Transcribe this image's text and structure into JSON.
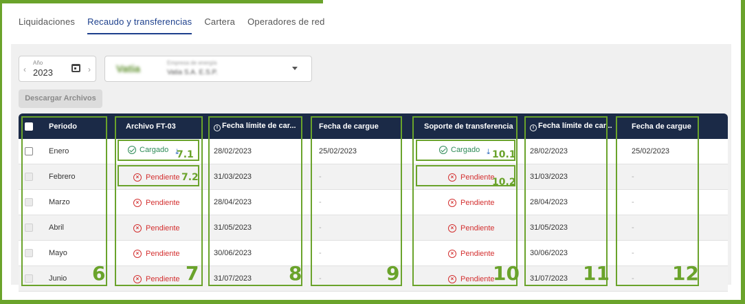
{
  "tabs": [
    {
      "label": "Liquidaciones",
      "active": false
    },
    {
      "label": "Recaudo y transferencias",
      "active": true
    },
    {
      "label": "Cartera",
      "active": false
    },
    {
      "label": "Operadores de red",
      "active": false
    }
  ],
  "filters": {
    "year_label": "Año",
    "year_value": "2023",
    "company_label": "Empresa de energía",
    "company_value": "Vatia S.A. E.S.P.",
    "company_logo": "Vatia"
  },
  "download_button": "Descargar Archivos",
  "table": {
    "headers": [
      "Periodo",
      "Archivo FT-03",
      "Fecha límite de car...",
      "Fecha de cargue",
      "Soporte de transferencia",
      "Fecha límite de car...",
      "Fecha de cargue"
    ],
    "rows": [
      {
        "periodo": "Enero",
        "archivo": "Cargado",
        "archivo_ok": true,
        "limite1": "28/02/2023",
        "cargue1": "25/02/2023",
        "soporte": "Cargado",
        "soporte_ok": true,
        "limite2": "28/02/2023",
        "cargue2": "25/02/2023"
      },
      {
        "periodo": "Febrero",
        "archivo": "Pendiente",
        "archivo_ok": false,
        "limite1": "31/03/2023",
        "cargue1": "-",
        "soporte": "Pendiente",
        "soporte_ok": false,
        "limite2": "31/03/2023",
        "cargue2": "-"
      },
      {
        "periodo": "Marzo",
        "archivo": "Pendiente",
        "archivo_ok": false,
        "limite1": "28/04/2023",
        "cargue1": "-",
        "soporte": "Pendiente",
        "soporte_ok": false,
        "limite2": "28/04/2023",
        "cargue2": "-"
      },
      {
        "periodo": "Abril",
        "archivo": "Pendiente",
        "archivo_ok": false,
        "limite1": "31/05/2023",
        "cargue1": "-",
        "soporte": "Pendiente",
        "soporte_ok": false,
        "limite2": "31/05/2023",
        "cargue2": "-"
      },
      {
        "periodo": "Mayo",
        "archivo": "Pendiente",
        "archivo_ok": false,
        "limite1": "30/06/2023",
        "cargue1": "-",
        "soporte": "Pendiente",
        "soporte_ok": false,
        "limite2": "30/06/2023",
        "cargue2": "-"
      },
      {
        "periodo": "Junio",
        "archivo": "Pendiente",
        "archivo_ok": false,
        "limite1": "31/07/2023",
        "cargue1": "-",
        "soporte": "Pendiente",
        "soporte_ok": false,
        "limite2": "31/07/2023",
        "cargue2": "-"
      }
    ]
  },
  "annotations": [
    "6",
    "7",
    "7.1",
    "7.2",
    "8",
    "9",
    "10",
    "10.1",
    "10.2",
    "11",
    "12"
  ],
  "colors": {
    "accent": "#6aa32b",
    "header_bg": "#1b2a47",
    "active_tab": "#1c3f8c",
    "ok": "#2e8b57",
    "pending": "#d32f2f"
  }
}
